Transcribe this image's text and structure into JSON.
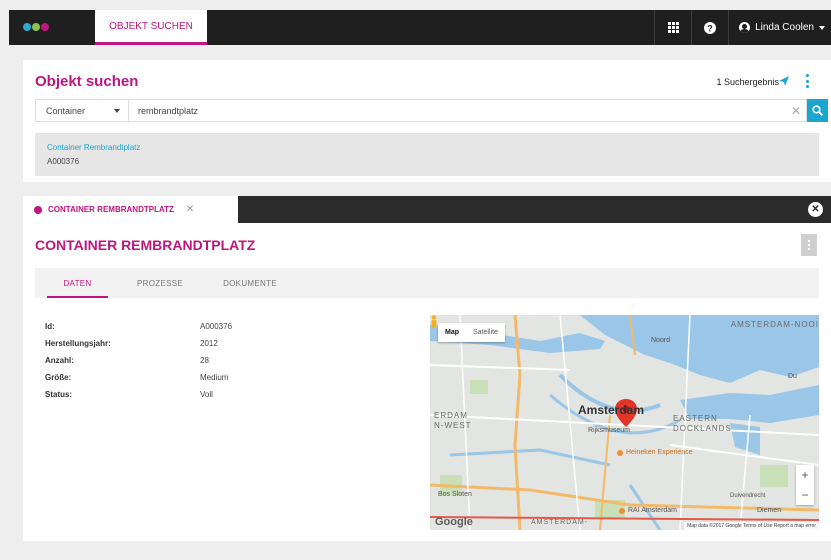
{
  "topbar": {
    "logo_colors": [
      "#29a9d6",
      "#8bc34a",
      "#c0157f"
    ],
    "active_tab": "OBJEKT SUCHEN",
    "user_name": "Linda Coolen"
  },
  "search": {
    "title": "Objekt suchen",
    "result_count": "1 Suchergebnis",
    "type_value": "Container",
    "query": "rembrandtplatz",
    "result": {
      "name": "Container Rembrandtplatz",
      "id": "A000376"
    }
  },
  "detail": {
    "tab_label": "CONTAINER REMBRANDTPLATZ",
    "title": "CONTAINER REMBRANDTPLATZ",
    "subtabs": [
      "DATEN",
      "PROZESSE",
      "DOKUMENTE"
    ],
    "properties": [
      {
        "label": "Id:",
        "value": "A000376"
      },
      {
        "label": "Herstellungsjahr:",
        "value": "2012"
      },
      {
        "label": "Anzahl:",
        "value": "28"
      },
      {
        "label": "Größe:",
        "value": "Medium"
      },
      {
        "label": "Status:",
        "value": "Voll"
      }
    ]
  },
  "map": {
    "toggle_map": "Map",
    "toggle_satellite": "Satellite",
    "city": "Amsterdam",
    "area_north": "AMSTERDAM-NOOI",
    "area_west": "ERDAM\nN-WEST",
    "area_east": "EASTERN\nDOCKLANDS",
    "area_south": "AMSTERDAM-",
    "labels": {
      "noord": "Noord",
      "rijksmuseum": "Rijksmuseum",
      "heineken": "Heineken Experience",
      "rai": "RAI Amsterdam",
      "bos": "Bos Sloten",
      "diemen": "Diemen",
      "duivendrecht": "Duivendrecht",
      "du": "Du"
    },
    "google": "Google",
    "attribution": "Map data ©2017 Google   Terms of Use   Report a map error",
    "accent": "#1ba6cf",
    "brand": "#c0157f"
  }
}
